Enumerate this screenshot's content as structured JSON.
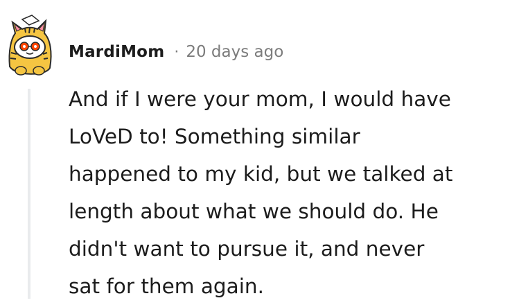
{
  "comment": {
    "username": "MardiMom",
    "separator": "·",
    "timestamp": "20 days ago",
    "body_lines": [
      "And if I were your mom, I would have",
      "LoVeD to! Something similar",
      "happened to my kid, but we talked at",
      "length about what we should do. He",
      "didn't want to pursue it, and never",
      "sat for them again."
    ],
    "avatar_icon": "snoo-tiger-costume-avatar",
    "thread_line_color": "#e9ebed"
  }
}
